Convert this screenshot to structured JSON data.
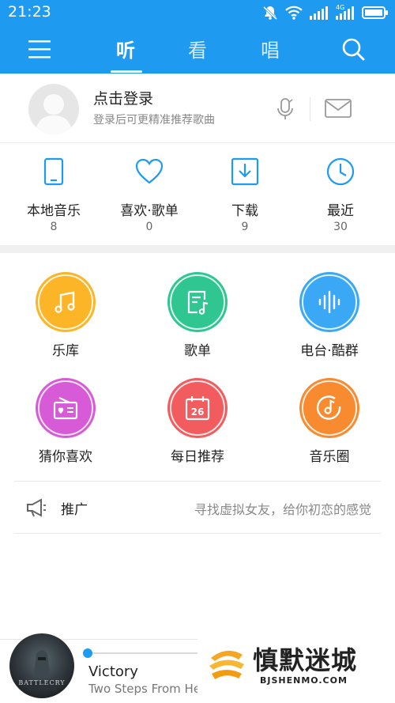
{
  "status_bar": {
    "time": "21:23",
    "network_label": "4G",
    "icons": [
      "mute-icon",
      "wifi-icon",
      "signal-icon",
      "signal-4g-icon",
      "battery-icon"
    ]
  },
  "topbar": {
    "tabs": [
      {
        "label": "听",
        "active": true
      },
      {
        "label": "看",
        "active": false
      },
      {
        "label": "唱",
        "active": false
      }
    ],
    "icons": [
      "menu-icon",
      "search-icon"
    ]
  },
  "login": {
    "title": "点击登录",
    "subtitle": "登录后可更精准推荐歌曲",
    "icons": [
      "avatar-placeholder",
      "mic-icon",
      "mail-icon"
    ]
  },
  "quick_items": [
    {
      "label": "本地音乐",
      "count": "8",
      "icon": "phone-icon"
    },
    {
      "label": "喜欢·歌单",
      "count": "0",
      "icon": "heart-icon"
    },
    {
      "label": "下载",
      "count": "9",
      "icon": "download-icon"
    },
    {
      "label": "最近",
      "count": "30",
      "icon": "clock-icon"
    }
  ],
  "grid_items": [
    {
      "label": "乐库",
      "icon": "music-note-icon",
      "color": "#fbb526"
    },
    {
      "label": "歌单",
      "icon": "playlist-icon",
      "color": "#2fc692"
    },
    {
      "label": "电台·酷群",
      "icon": "sound-wave-icon",
      "color": "#3ba8f5"
    },
    {
      "label": "猜你喜欢",
      "icon": "radio-heart-icon",
      "color": "#d75ad6"
    },
    {
      "label": "每日推荐",
      "icon": "calendar-icon",
      "color": "#f25c5e",
      "badge": "26"
    },
    {
      "label": "音乐圈",
      "icon": "music-circle-icon",
      "color": "#f88a2f"
    }
  ],
  "promo": {
    "label": "推广",
    "text": "寻找虚拟女友，给你初恋的感觉",
    "icon": "megaphone-icon"
  },
  "player": {
    "song_title": "Victory",
    "artist": "Two Steps From Hell",
    "album_text": "BATTLECRY",
    "progress": 0.0
  },
  "watermark": {
    "title": "慎默迷城",
    "subtitle": "BJSHENMO.COM"
  },
  "colors": {
    "brand_blue": "#1e9bf0"
  }
}
